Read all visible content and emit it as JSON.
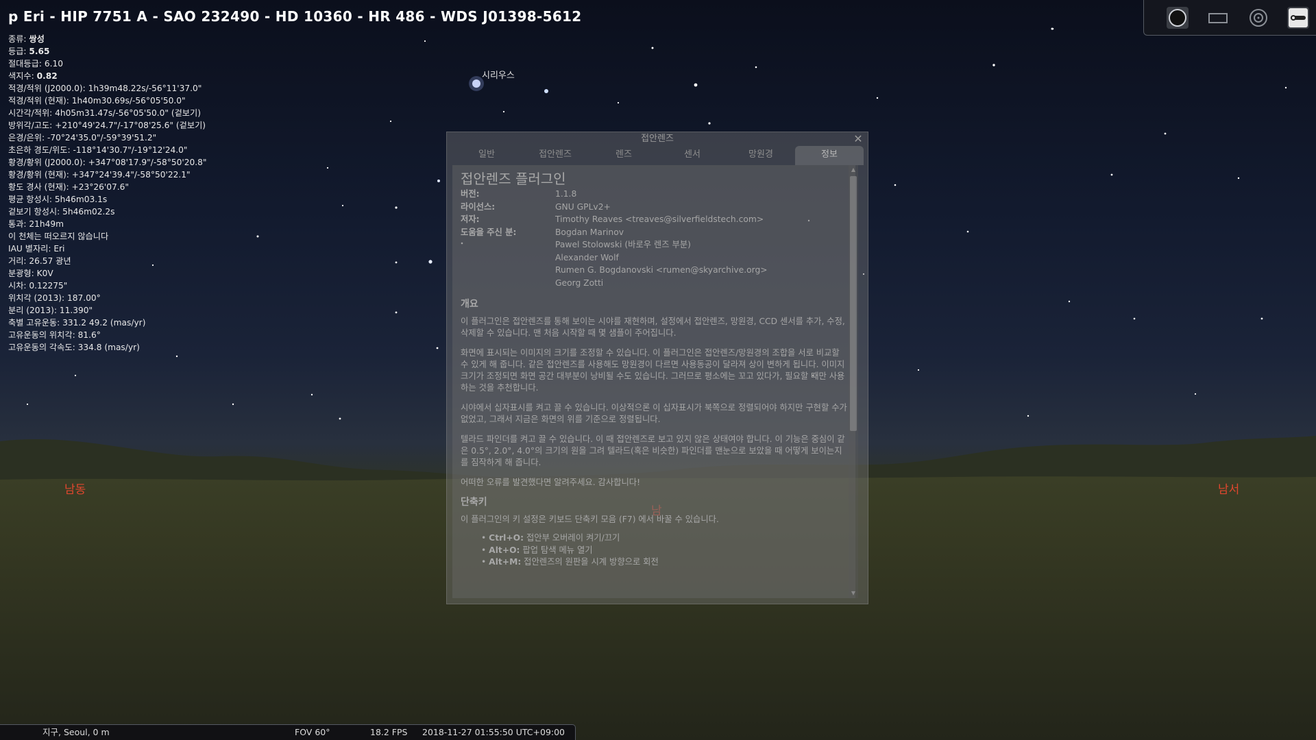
{
  "object": {
    "title": "p Eri - HIP 7751 A - SAO 232490 - HD 10360 - HR 486 - WDS J01398-5612",
    "info_rows": [
      {
        "label": "종류: ",
        "value": "쌍성",
        "bold": true
      },
      {
        "label": "등급: ",
        "value": "5.65",
        "bold": true
      },
      {
        "label": "절대등급: ",
        "value": "6.10",
        "bold": false
      },
      {
        "label": "색지수: ",
        "value": "0.82",
        "bold": true
      },
      {
        "label": "적경/적위 (J2000.0): ",
        "value": "1h39m48.22s/-56°11'37.0\"",
        "bold": false
      },
      {
        "label": "적경/적위 (현재): ",
        "value": "1h40m30.69s/-56°05'50.0\"",
        "bold": false
      },
      {
        "label": "시간각/적위: ",
        "value": "4h05m31.47s/-56°05'50.0\" (겉보기)",
        "bold": false
      },
      {
        "label": "방위각/고도: ",
        "value": "+210°49'24.7\"/-17°08'25.6\" (겉보기)",
        "bold": false
      },
      {
        "label": "은경/은위: ",
        "value": "-70°24'35.0\"/-59°39'51.2\"",
        "bold": false
      },
      {
        "label": "초은하 경도/위도: ",
        "value": "-118°14'30.7\"/-19°12'24.0\"",
        "bold": false
      },
      {
        "label": "황경/황위 (J2000.0): ",
        "value": "+347°08'17.9\"/-58°50'20.8\"",
        "bold": false
      },
      {
        "label": "황경/황위 (현재): ",
        "value": "+347°24'39.4\"/-58°50'22.1\"",
        "bold": false
      },
      {
        "label": "황도 경사 (현재): ",
        "value": "+23°26'07.6\"",
        "bold": false
      },
      {
        "label": "평균 항성시: ",
        "value": "5h46m03.1s",
        "bold": false
      },
      {
        "label": "겉보기 항성시: ",
        "value": "5h46m02.2s",
        "bold": false
      },
      {
        "label": "통과: ",
        "value": "21h49m",
        "bold": false
      },
      {
        "label": "",
        "value": "이 천체는 떠오르지 않습니다",
        "bold": false
      },
      {
        "label": "IAU 별자리: ",
        "value": "Eri",
        "bold": false
      },
      {
        "label": "거리: ",
        "value": "26.57 광년",
        "bold": false
      },
      {
        "label": "분광형: ",
        "value": "K0V",
        "bold": false
      },
      {
        "label": "시차: ",
        "value": "0.12275\"",
        "bold": false
      },
      {
        "label": "위치각 (2013): ",
        "value": "187.00°",
        "bold": false
      },
      {
        "label": "분리 (2013): ",
        "value": "11.390\"",
        "bold": false
      },
      {
        "label": "축별 고유운동: ",
        "value": "331.2 49.2 (mas/yr)",
        "bold": false
      },
      {
        "label": "고유운동의 위치각: ",
        "value": "81.6°",
        "bold": false
      },
      {
        "label": "고유운동의 각속도: ",
        "value": "334.8 (mas/yr)",
        "bold": false
      }
    ]
  },
  "sky": {
    "sirius_label": "시리우스",
    "cardinal_se": "남동",
    "cardinal_s": "남",
    "cardinal_sw": "남서"
  },
  "toolbar": {
    "icons": [
      "ocular-circle-icon",
      "ccd-frame-icon",
      "telrad-icon",
      "ocular-config-icon"
    ]
  },
  "dialog": {
    "title": "접안렌즈",
    "close_glyph": "✕",
    "tabs": [
      "일반",
      "접안렌즈",
      "렌즈",
      "센서",
      "망원경",
      "정보"
    ],
    "active_tab": "정보",
    "content": {
      "heading": "접안렌즈 플러그인",
      "meta": [
        {
          "key": "버전:",
          "value": "1.1.8"
        },
        {
          "key": "라이선스:",
          "value": "GNU GPLv2+"
        },
        {
          "key": "저자:",
          "value": "Timothy Reaves <treaves@silverfieldstech.com>"
        }
      ],
      "contributors_label": "도움을 주신 분:",
      "contributors": [
        "Bogdan Marinov",
        "Pawel Stolowski (바로우 렌즈 부분)",
        "Alexander Wolf",
        "Rumen G. Bogdanovski <rumen@skyarchive.org>",
        "Georg Zotti"
      ],
      "overview_heading": "개요",
      "paragraphs": [
        "이 플러그인은 접안렌즈를 통해 보이는 시야를 재현하며, 설정에서 접안렌즈, 망원경, CCD 센서를 추가, 수정, 삭제할 수 있습니다. 맨 처음 시작할 때 몇 샘플이 주어집니다.",
        "화면에 표시되는 이미지의 크기를 조정할 수 있습니다. 이 플러그인은 접안렌즈/망원경의 조합을 서로 비교할 수 있게 해 줍니다. 같은 접안렌즈를 사용해도 망원경이 다르면 사용동공이 달라져 상이 변하게 됩니다. 이미지 크기가 조정되면 화면 공간 대부분이 낭비될 수도 있습니다. 그러므로 평소에는 꼬고 있다가, 필요할 때만 사용하는 것을 추천합니다.",
        "시야에서 십자표시를 켜고 끌 수 있습니다. 이상적으론 이 십자표시가 북쪽으로 정렬되어야 하지만 구현할 수가 없었고, 그래서 지금은 화면의 위를 기준으로 정렬됩니다.",
        "텔라드 파인더를 켜고 끌 수 있습니다. 이 때 접안렌즈로 보고 있지 않은 상태여야 합니다. 이 기능은 중심이 같은 0.5°, 2.0°, 4.0°의 크기의 원을 그려 텔라드(혹은 비슷한) 파인더를 맨눈으로 보았을 때 어떻게 보이는지를 짐작하게 해 줍니다.",
        "어떠한 오류를 발견했다면 알려주세요. 감사합니다!"
      ],
      "shortcuts_heading": "단축키",
      "shortcuts_intro": "이 플러그인의 키 설정은 키보드 단축키 모음 (F7) 에서 바꿀 수 있습니다.",
      "shortcuts": [
        {
          "key": "Ctrl+O:",
          "desc": " 접안부 오버레이 켜기/끄기"
        },
        {
          "key": "Alt+O:",
          "desc": " 팝업 탐색 메뉴 열기"
        },
        {
          "key": "Alt+M:",
          "desc": " 접안렌즈의 원판을 시계 방향으로 회전"
        }
      ]
    },
    "scrollbar": {
      "up_glyph": "▲",
      "down_glyph": "▼",
      "visible_fraction": 0.62
    }
  },
  "status": {
    "location": "지구, Seoul, 0 m",
    "fov": "FOV 60°",
    "fps": "18.2 FPS",
    "datetime": "2018-11-27 01:55:50 UTC+09:00"
  }
}
